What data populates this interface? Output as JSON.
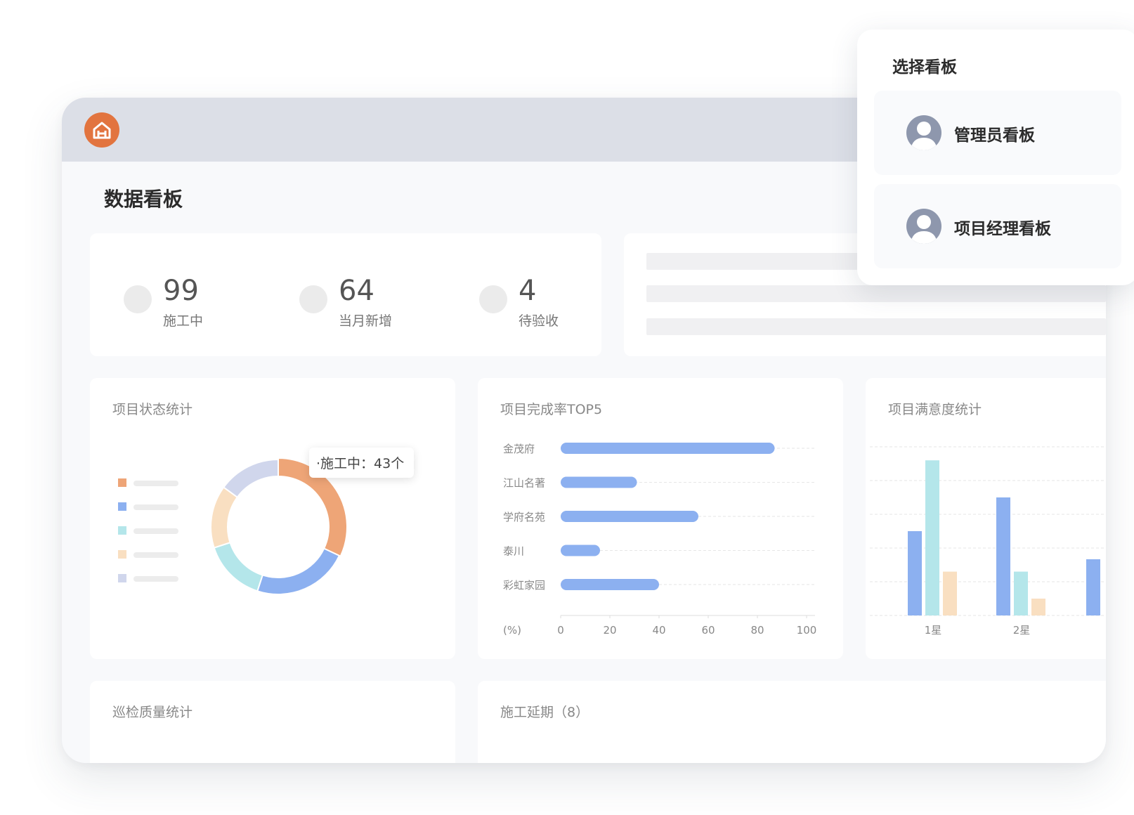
{
  "page": {
    "title": "数据看板"
  },
  "stats": [
    {
      "value": "99",
      "label": "施工中"
    },
    {
      "value": "64",
      "label": "当月新增"
    },
    {
      "value": "4",
      "label": "待验收"
    }
  ],
  "cards": {
    "status": "项目状态统计",
    "completion": "项目完成率TOP5",
    "satisfaction": "项目满意度统计",
    "inspection": "巡检质量统计",
    "delay": "施工延期（8）"
  },
  "tooltip": "·施工中：43个",
  "popup": {
    "title": "选择看板",
    "items": [
      {
        "label": "管理员看板"
      },
      {
        "label": "项目经理看板"
      }
    ]
  },
  "colors": {
    "orange": "#eea577",
    "blue": "#8cb0f0",
    "cyan": "#b4e6ea",
    "peach": "#f9dfc1",
    "lavender": "#d0d6ec",
    "brand": "#e2743f"
  },
  "chart_data": [
    {
      "type": "pie",
      "title": "项目状态统计",
      "slices": [
        {
          "value": 32,
          "color": "#eea577"
        },
        {
          "value": 23,
          "color": "#8cb0f0"
        },
        {
          "value": 15,
          "color": "#b4e6ea"
        },
        {
          "value": 15,
          "color": "#f9dfc1"
        },
        {
          "value": 15,
          "color": "#d0d6ec"
        }
      ]
    },
    {
      "type": "bar",
      "title": "项目完成率TOP5",
      "orientation": "horizontal",
      "categories": [
        "金茂府",
        "江山名著",
        "学府名苑",
        "泰川",
        "彩虹家园"
      ],
      "values": [
        87,
        31,
        56,
        16,
        40
      ],
      "xlabel": "(%)",
      "xlim": [
        0,
        100
      ],
      "xticks": [
        "0",
        "20",
        "40",
        "60",
        "80",
        "100"
      ],
      "grid": true
    },
    {
      "type": "bar",
      "title": "项目满意度统计",
      "categories": [
        "1星",
        "2星"
      ],
      "series": [
        {
          "values": [
            2.5,
            3.5
          ],
          "color": "#8cb0f0"
        },
        {
          "values": [
            4.6,
            1.3
          ],
          "color": "#b4e6ea"
        },
        {
          "values": [
            1.3,
            0.5
          ],
          "color": "#f9dfc1"
        }
      ],
      "ylim": [
        0,
        5
      ],
      "grid": true
    }
  ]
}
